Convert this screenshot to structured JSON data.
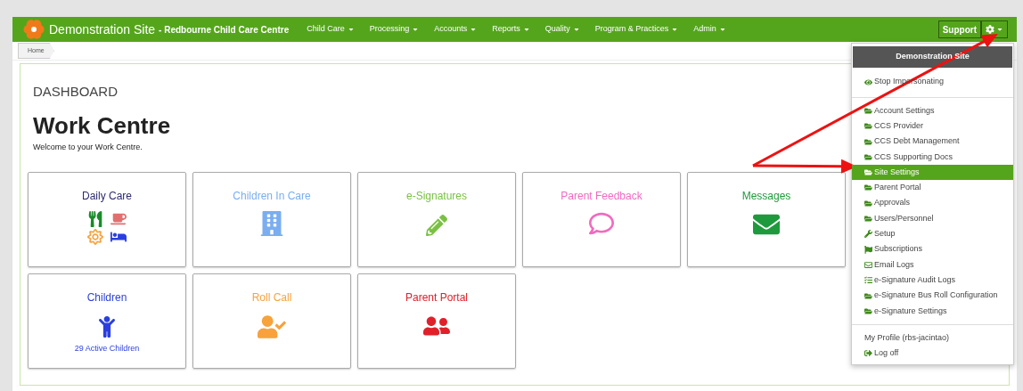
{
  "navbar": {
    "brand": "Demonstration Site",
    "site_name": "- Redbourne Child Care Centre",
    "items": [
      {
        "label": "Child Care"
      },
      {
        "label": "Processing"
      },
      {
        "label": "Accounts"
      },
      {
        "label": "Reports"
      },
      {
        "label": "Quality"
      },
      {
        "label": "Program & Practices"
      },
      {
        "label": "Admin"
      }
    ],
    "support": "Support"
  },
  "breadcrumb": [
    "Home"
  ],
  "page": {
    "section": "DASHBOARD",
    "title": "Work Centre",
    "subtitle": "Welcome to your Work Centre."
  },
  "cards": [
    {
      "title": "Daily Care",
      "color": "#2d2d6e",
      "kind": "daily-care"
    },
    {
      "title": "Children In Care",
      "color": "#7aaef0",
      "kind": "building"
    },
    {
      "title": "e-Signatures",
      "color": "#7ac143",
      "kind": "pencil"
    },
    {
      "title": "Parent Feedback",
      "color": "#f06bc0",
      "kind": "comment"
    },
    {
      "title": "Messages",
      "color": "#1e9a3c",
      "kind": "envelope"
    },
    {
      "title": "Children",
      "color": "#2b3fe0",
      "kind": "child",
      "subtitle": "29 Active Children"
    },
    {
      "title": "Roll Call",
      "color": "#f7a23c",
      "kind": "user-check"
    },
    {
      "title": "Parent Portal",
      "color": "#e0202a",
      "kind": "family"
    }
  ],
  "menu": {
    "header": "Demonstration Site",
    "sections": [
      [
        {
          "label": "Stop Impersonating",
          "kind": "eye",
          "selected": false
        }
      ],
      [
        {
          "label": "Account Settings",
          "kind": "folder",
          "selected": false
        },
        {
          "label": "CCS Provider",
          "kind": "folder",
          "selected": false
        },
        {
          "label": "CCS Debt Management",
          "kind": "folder",
          "selected": false
        },
        {
          "label": "CCS Supporting Docs",
          "kind": "folder",
          "selected": false
        },
        {
          "label": "Site Settings",
          "kind": "folder",
          "selected": true
        },
        {
          "label": "Parent Portal",
          "kind": "folder",
          "selected": false
        },
        {
          "label": "Approvals",
          "kind": "folder",
          "selected": false
        },
        {
          "label": "Users/Personnel",
          "kind": "folder",
          "selected": false
        },
        {
          "label": "Setup",
          "kind": "wrench",
          "selected": false
        },
        {
          "label": "Subscriptions",
          "kind": "flag",
          "selected": false
        },
        {
          "label": "Email Logs",
          "kind": "mail",
          "selected": false
        },
        {
          "label": "e-Signature Audit Logs",
          "kind": "list",
          "selected": false
        },
        {
          "label": "e-Signature Bus Roll Configuration",
          "kind": "folder",
          "selected": false
        },
        {
          "label": "e-Signature Settings",
          "kind": "folder",
          "selected": false
        }
      ],
      [
        {
          "label": "My Profile (rbs-jacintao)",
          "kind": "text",
          "selected": false
        },
        {
          "label": "Log off",
          "kind": "signout",
          "selected": false
        }
      ]
    ]
  }
}
